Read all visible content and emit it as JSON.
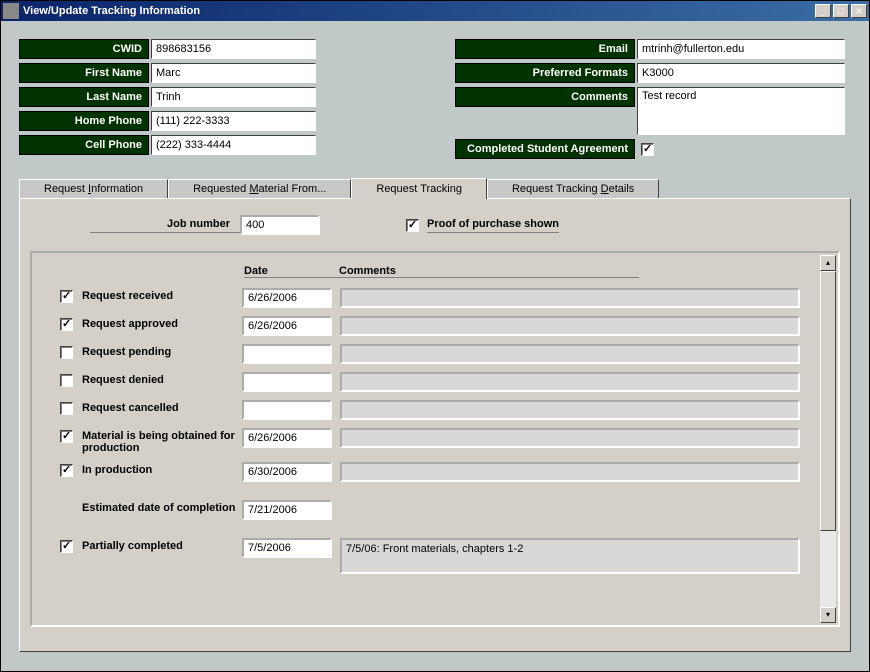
{
  "window": {
    "title": "View/Update Tracking Information"
  },
  "header": {
    "left": {
      "cwid_label": "CWID",
      "cwid": "898683156",
      "first_name_label": "First Name",
      "first_name": "Marc",
      "last_name_label": "Last Name",
      "last_name": "Trinh",
      "home_phone_label": "Home Phone",
      "home_phone": "(111) 222-3333",
      "cell_phone_label": "Cell Phone",
      "cell_phone": "(222) 333-4444"
    },
    "right": {
      "email_label": "Email",
      "email": "mtrinh@fullerton.edu",
      "formats_label": "Preferred Formats",
      "formats": "K3000",
      "comments_label": "Comments",
      "comments": "Test record",
      "agreement_label": "Completed Student Agreement",
      "agreement_checked": true
    }
  },
  "tabs": {
    "t1": "Request Information",
    "t2": "Requested Material From...",
    "t3": "Request Tracking",
    "t4": "Request Tracking Details"
  },
  "jobline": {
    "label": "Job number",
    "value": "400",
    "proof_label": "Proof of purchase shown",
    "proof_checked": true
  },
  "grid": {
    "date_header": "Date",
    "comments_header": "Comments",
    "rows": [
      {
        "checked": true,
        "label": "Request received",
        "date": "6/26/2006",
        "comment": ""
      },
      {
        "checked": true,
        "label": "Request approved",
        "date": "6/26/2006",
        "comment": ""
      },
      {
        "checked": false,
        "label": "Request pending",
        "date": "",
        "comment": ""
      },
      {
        "checked": false,
        "label": "Request denied",
        "date": "",
        "comment": ""
      },
      {
        "checked": false,
        "label": "Request cancelled",
        "date": "",
        "comment": ""
      },
      {
        "checked": true,
        "label": "Material is being obtained for production",
        "date": "6/26/2006",
        "comment": ""
      },
      {
        "checked": true,
        "label": "In production",
        "date": "6/30/2006",
        "comment": ""
      },
      {
        "checked": null,
        "label": "Estimated date of completion",
        "date": "7/21/2006",
        "comment": null
      },
      {
        "checked": true,
        "label": "Partially completed",
        "date": "7/5/2006",
        "comment": "7/5/06: Front materials, chapters 1-2"
      }
    ]
  }
}
